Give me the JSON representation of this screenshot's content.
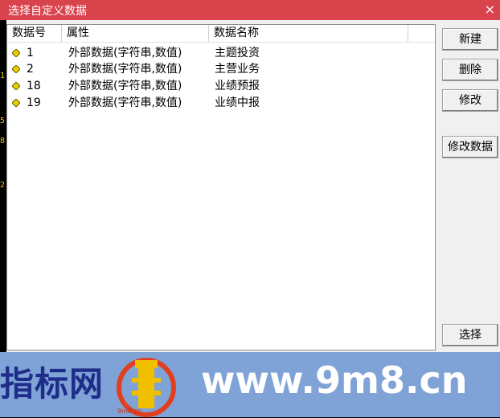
{
  "window": {
    "title": "选择自定义数据",
    "close_glyph": "×"
  },
  "leftstrip": [
    "1",
    "5",
    "8",
    "2"
  ],
  "table": {
    "columns": [
      "数据号",
      "属性",
      "数据名称"
    ],
    "rows": [
      {
        "id": "1",
        "attr": "外部数据(字符串,数值)",
        "name": "主题投资"
      },
      {
        "id": "2",
        "attr": "外部数据(字符串,数值)",
        "name": "主营业务"
      },
      {
        "id": "18",
        "attr": "外部数据(字符串,数值)",
        "name": "业绩预报"
      },
      {
        "id": "19",
        "attr": "外部数据(字符串,数值)",
        "name": "业绩中报"
      }
    ]
  },
  "buttons": {
    "new": "新建",
    "delete": "删除",
    "modify": "修改",
    "modify_data": "修改数据",
    "select": "选择"
  },
  "banner": {
    "left_text": "指标网",
    "url": "www.9m8.cn",
    "logo_text": "9m8.cn"
  },
  "colors": {
    "title_bar": "#d9434c",
    "banner_bg": "#7fa3d6",
    "diamond": "#e8d000"
  }
}
